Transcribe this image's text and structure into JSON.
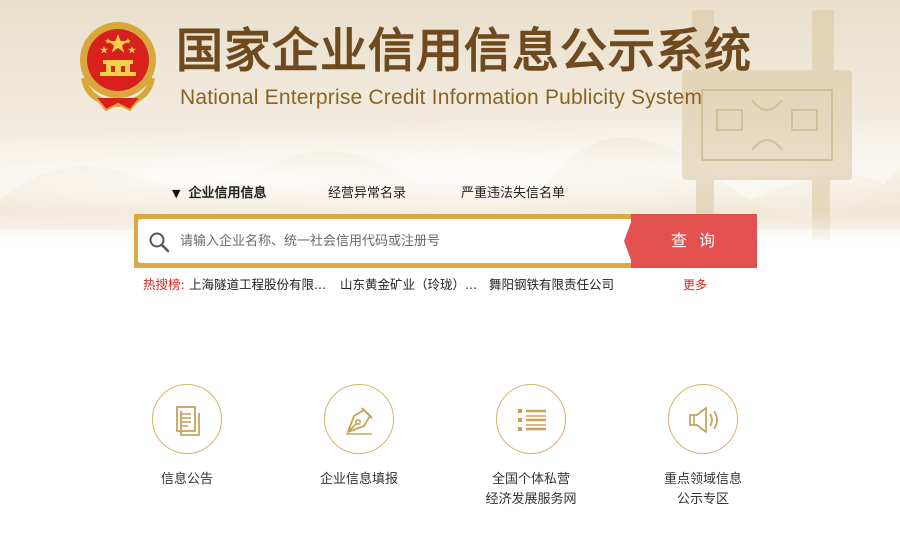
{
  "header": {
    "title": "国家企业信用信息公示系统",
    "subtitle": "National Enterprise Credit Information Publicity System",
    "emblem_icon": "national-emblem-icon"
  },
  "tabs": [
    {
      "label": "企业信用信息",
      "active": true
    },
    {
      "label": "经营异常名录",
      "active": false
    },
    {
      "label": "严重违法失信名单",
      "active": false
    }
  ],
  "search": {
    "placeholder": "请输入企业名称、统一社会信用代码或注册号",
    "value": "",
    "button_label": "查询"
  },
  "hot_search": {
    "label": "热搜榜:",
    "items": [
      "上海隧道工程股份有限...",
      "山东黄金矿业（玲珑）...",
      "舞阳钢铁有限责任公司"
    ],
    "more_label": "更多"
  },
  "quick_links": [
    {
      "line1": "信息公告",
      "line2": "",
      "icon": "document-icon"
    },
    {
      "line1": "企业信息填报",
      "line2": "",
      "icon": "pen-nib-icon"
    },
    {
      "line1": "全国个体私营",
      "line2": "经济发展服务网",
      "icon": "list-icon"
    },
    {
      "line1": "重点领域信息",
      "line2": "公示专区",
      "icon": "speaker-icon"
    }
  ],
  "colors": {
    "accent_gold": "#d9a948",
    "button_red": "#e2514f",
    "title_brown": "#6e4a1e",
    "hot_red": "#d4241d",
    "icon_gold": "#c9a25a"
  }
}
